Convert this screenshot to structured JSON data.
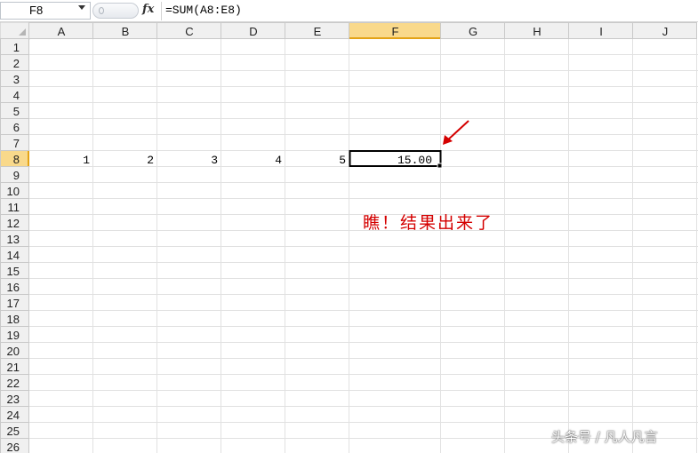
{
  "app": {
    "name_box": "F8",
    "fx_icon": "fx-icon",
    "formula": "=SUM(A8:E8)"
  },
  "columns": [
    "A",
    "B",
    "C",
    "D",
    "E",
    "F",
    "G",
    "H",
    "I",
    "J"
  ],
  "selected_column": "F",
  "rows": [
    "1",
    "2",
    "3",
    "4",
    "5",
    "6",
    "7",
    "8",
    "9",
    "10",
    "11",
    "12",
    "13",
    "14",
    "15",
    "16",
    "17",
    "18",
    "19",
    "20",
    "21",
    "22",
    "23",
    "24",
    "25",
    "26"
  ],
  "selected_row": "8",
  "cells": [
    {
      "ref": "A8",
      "col": "A",
      "row": "8",
      "value": "1"
    },
    {
      "ref": "B8",
      "col": "B",
      "row": "8",
      "value": "2"
    },
    {
      "ref": "C8",
      "col": "C",
      "row": "8",
      "value": "3"
    },
    {
      "ref": "D8",
      "col": "D",
      "row": "8",
      "value": "4"
    },
    {
      "ref": "E8",
      "col": "E",
      "row": "8",
      "value": "5"
    },
    {
      "ref": "F8",
      "col": "F",
      "row": "8",
      "value": "15.00"
    }
  ],
  "active_cell": "F8",
  "annotation": {
    "text": "瞧！结果出来了",
    "arrow": "red-arrow-icon"
  },
  "watermark": "头条号 / 凡人凡言",
  "colors": {
    "header_bg": "#f0f0f0",
    "header_selected_bg": "#f9d98b",
    "grid_line": "#e1e1e1",
    "header_line": "#c9c9c9",
    "annotation": "#d40000",
    "selection_border": "#000000"
  }
}
